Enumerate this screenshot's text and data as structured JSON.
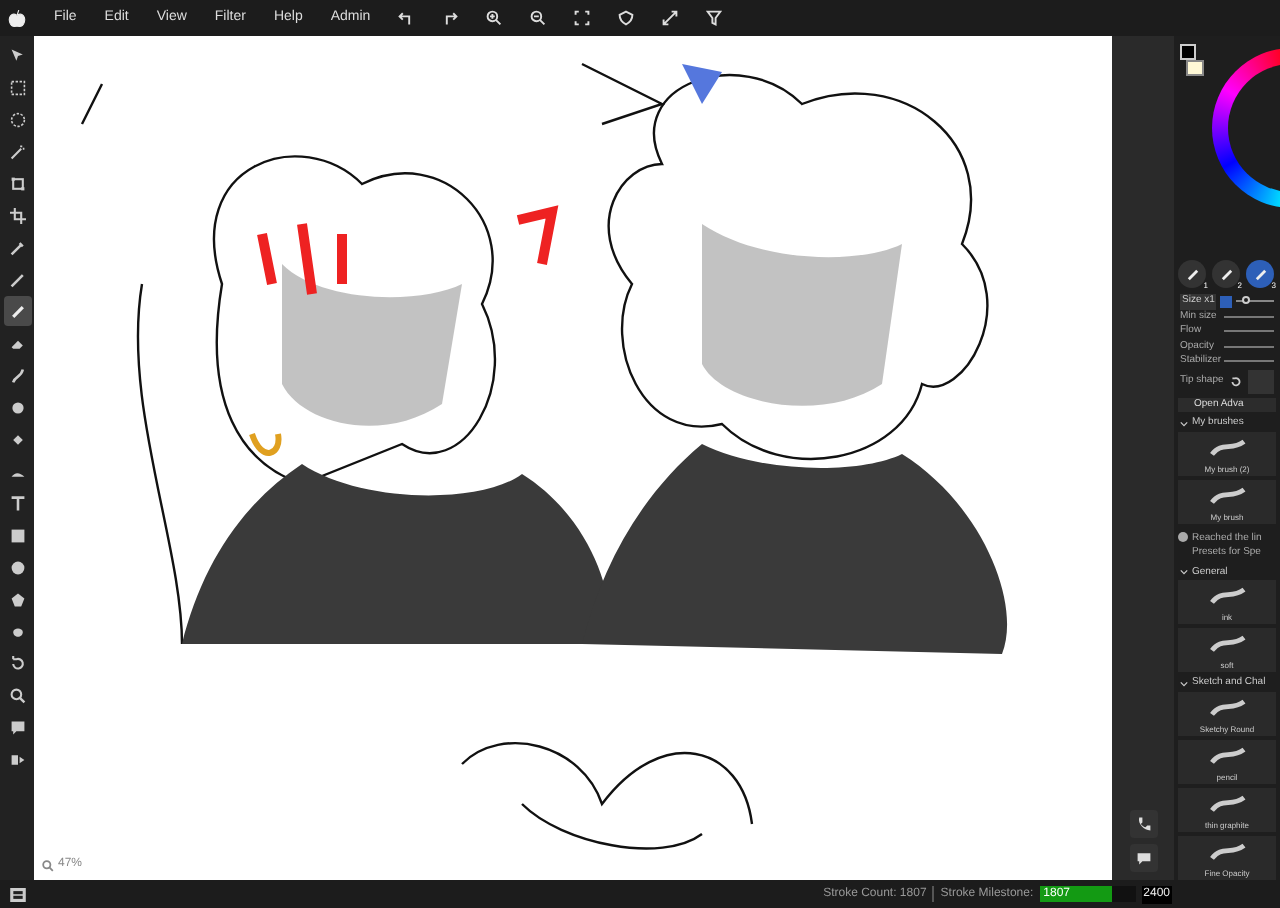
{
  "menu": [
    "File",
    "Edit",
    "View",
    "Filter",
    "Help",
    "Admin"
  ],
  "tools": [
    {
      "selected": false
    },
    {
      "selected": false
    },
    {
      "selected": false
    },
    {
      "selected": false
    },
    {
      "selected": false
    },
    {
      "selected": false
    },
    {
      "selected": false
    },
    {
      "selected": false
    },
    {
      "selected": true
    },
    {
      "selected": false
    },
    {
      "selected": false
    },
    {
      "selected": false
    },
    {
      "selected": false
    },
    {
      "selected": false
    },
    {
      "selected": false
    },
    {
      "selected": false
    },
    {
      "selected": false
    },
    {
      "selected": false
    },
    {
      "selected": false
    },
    {
      "selected": false
    },
    {
      "selected": false
    },
    {
      "selected": false
    },
    {
      "selected": false
    }
  ],
  "zoom": "47%",
  "brush_slots": [
    {
      "badge": "1",
      "selected": false
    },
    {
      "badge": "2",
      "selected": false
    },
    {
      "badge": "3",
      "selected": true
    }
  ],
  "settings": {
    "size": {
      "label": "Size x1",
      "level": 0.15
    },
    "rows": [
      "Min size",
      "Flow",
      "Opacity",
      "Stabilizer"
    ],
    "tip_label": "Tip shape",
    "open_button": "Open Adva"
  },
  "brush_groups": [
    {
      "title": "My brushes",
      "expanded": true,
      "brushes": [
        "My brush (2)",
        "My brush"
      ]
    },
    {
      "notice": [
        "Reached the lin",
        "Presets for Spe"
      ]
    },
    {
      "title": "General",
      "expanded": true,
      "brushes": [
        "ink",
        "soft"
      ]
    },
    {
      "title": "Sketch and Chal",
      "expanded": true,
      "brushes": [
        "Sketchy Round",
        "pencil",
        "thin graphite",
        "Fine Opacity"
      ]
    }
  ],
  "status": {
    "count_label": "Stroke Count: 1807",
    "milestone_label": "Stroke Milestone:",
    "progress_text": "1807",
    "level": 0.753,
    "goal": "2400"
  }
}
